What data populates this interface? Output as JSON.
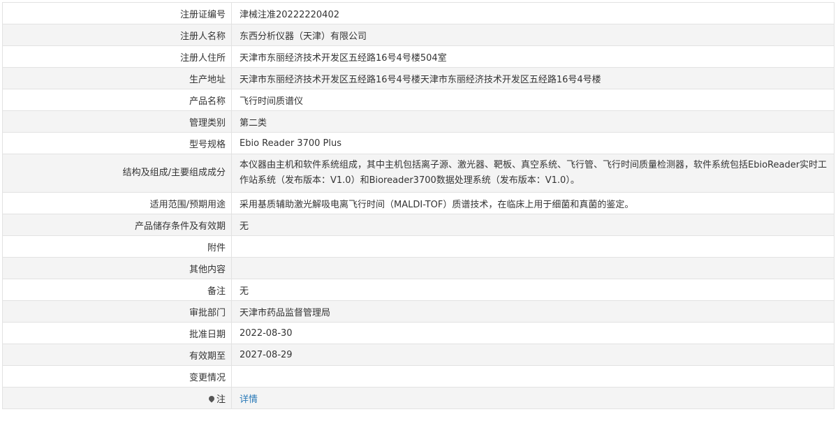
{
  "rows": [
    {
      "label": "注册证编号",
      "value": "津械注准20222220402"
    },
    {
      "label": "注册人名称",
      "value": "东西分析仪器（天津）有限公司"
    },
    {
      "label": "注册人住所",
      "value": "天津市东丽经济技术开发区五经路16号4号楼504室"
    },
    {
      "label": "生产地址",
      "value": "天津市东丽经济技术开发区五经路16号4号楼天津市东丽经济技术开发区五经路16号4号楼"
    },
    {
      "label": "产品名称",
      "value": "飞行时间质谱仪"
    },
    {
      "label": "管理类别",
      "value": "第二类"
    },
    {
      "label": "型号规格",
      "value": "Ebio Reader 3700 Plus"
    },
    {
      "label": "结构及组成/主要组成成分",
      "value": "本仪器由主机和软件系统组成，其中主机包括离子源、激光器、靶板、真空系统、飞行管、飞行时间质量检测器，软件系统包括EbioReader实时工作站系统（发布版本：V1.0）和Bioreader3700数据处理系统（发布版本：V1.0）。"
    },
    {
      "label": "适用范围/预期用途",
      "value": "采用基质辅助激光解吸电离飞行时间（MALDI-TOF）质谱技术，在临床上用于细菌和真菌的鉴定。"
    },
    {
      "label": "产品储存条件及有效期",
      "value": "无"
    },
    {
      "label": "附件",
      "value": ""
    },
    {
      "label": "其他内容",
      "value": ""
    },
    {
      "label": "备注",
      "value": "无"
    },
    {
      "label": "审批部门",
      "value": "天津市药品监督管理局"
    },
    {
      "label": "批准日期",
      "value": "2022-08-30"
    },
    {
      "label": "有效期至",
      "value": "2027-08-29"
    },
    {
      "label": "变更情况",
      "value": ""
    }
  ],
  "note": {
    "label": "注",
    "icon": "pin-icon",
    "link_text": "详情"
  }
}
